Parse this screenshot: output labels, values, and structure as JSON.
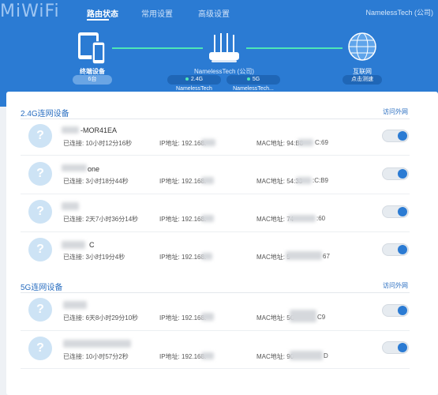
{
  "header": {
    "logo": "MiWiFi",
    "nav": [
      "路由状态",
      "常用设置",
      "高级设置"
    ],
    "account": "NamelessTech (公司)"
  },
  "topology": {
    "devices_label": "终端设备",
    "devices_count": "6台",
    "router_name": "NamelessTech (公司)",
    "ssid_24": "2.4G NamelessTech",
    "ssid_5": "5G NamelessTech...",
    "internet_label": "互联网",
    "internet_status": "点击测速"
  },
  "sections": [
    {
      "title": "2.4G连网设备",
      "link": "访问外网",
      "devices": [
        {
          "name": "-MOR41EA",
          "connected": "已连接: 10小时12分16秒",
          "ip": "IP地址: 192.168.",
          "mac": "MAC地址: 94:B8",
          "mac_tail": "C:69"
        },
        {
          "name": "one",
          "connected": "已连接: 3小时18分44秒",
          "ip": "IP地址: 192.168.",
          "mac": "MAC地址: 54:33",
          "mac_tail": ":C:B9"
        },
        {
          "name": "",
          "connected": "已连接: 2天7小时36分14秒",
          "ip": "IP地址: 192.168.",
          "mac": "MAC地址: 74",
          "mac_tail": ":60"
        },
        {
          "name": "C",
          "connected": "已连接: 3小时19分4秒",
          "ip": "IP地址: 192.168.",
          "mac": "MAC地址: 5",
          "mac_tail": "67"
        }
      ]
    },
    {
      "title": "5G连网设备",
      "link": "访问外网",
      "devices": [
        {
          "name": "",
          "connected": "已连接: 6天8小时29分10秒",
          "ip": "IP地址: 192.168.",
          "mac": "MAC地址: 5C",
          "mac_tail": "C9"
        },
        {
          "name": "",
          "connected": "已连接: 10小时57分2秒",
          "ip": "IP地址: 192.168.",
          "mac": "MAC地址: 90",
          "mac_tail": "D"
        }
      ]
    }
  ]
}
